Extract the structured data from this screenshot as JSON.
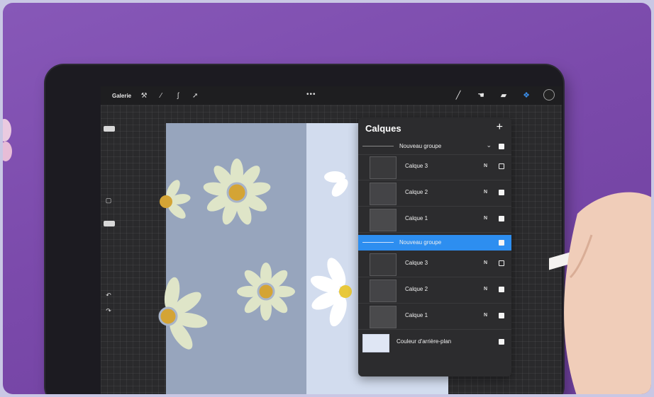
{
  "topbar": {
    "gallery_label": "Galerie",
    "left_tools": [
      "wrench-icon",
      "magic-wand-icon",
      "selection-icon",
      "transform-arrow-icon"
    ],
    "more_label": "•••",
    "right_tools": [
      "brush-icon",
      "smudge-icon",
      "eraser-icon",
      "layers-icon",
      "color-circle"
    ]
  },
  "layers_panel": {
    "title": "Calques",
    "add_label": "+",
    "rows": [
      {
        "kind": "group",
        "label": "Nouveau groupe",
        "blend": "",
        "visible": true,
        "expanded": true
      },
      {
        "kind": "layer",
        "label": "Calque 3",
        "blend": "N",
        "visible": false
      },
      {
        "kind": "layer",
        "label": "Calque 2",
        "blend": "N",
        "visible": true
      },
      {
        "kind": "layer",
        "label": "Calque 1",
        "blend": "N",
        "visible": true
      },
      {
        "kind": "group",
        "label": "Nouveau groupe",
        "blend": "",
        "visible": true,
        "selected": true
      },
      {
        "kind": "layer",
        "label": "Calque 3",
        "blend": "N",
        "visible": false
      },
      {
        "kind": "layer",
        "label": "Calque 2",
        "blend": "N",
        "visible": true
      },
      {
        "kind": "layer",
        "label": "Calque 1",
        "blend": "N",
        "visible": true
      },
      {
        "kind": "background",
        "label": "Couleur d'arrière-plan",
        "blend": "",
        "visible": true
      }
    ]
  },
  "colors": {
    "accent": "#2d8ef0",
    "canvas_left": "#97a5bd",
    "canvas_right": "#d2dcee",
    "petal": "#dfe5c8",
    "flower_center": "#d4a435"
  }
}
